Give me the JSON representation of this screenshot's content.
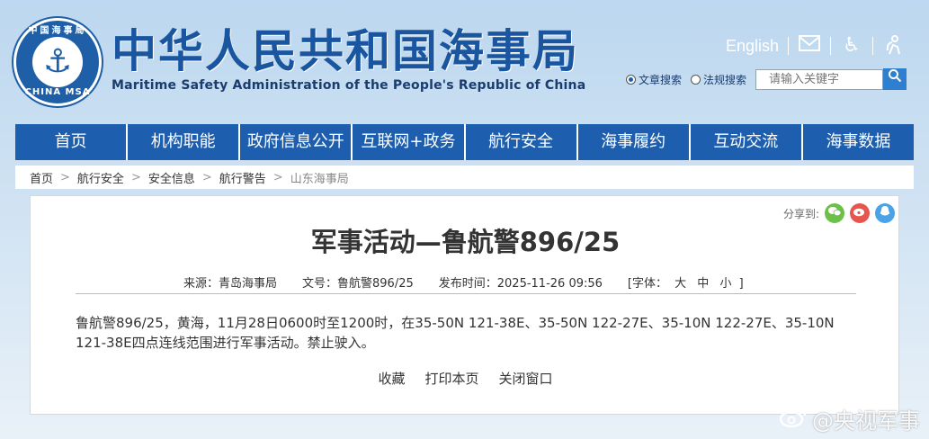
{
  "header": {
    "emblem_ring_top": "中国海事局",
    "emblem_ring_bottom": "CHINA MSA",
    "title": "中华人民共和国海事局",
    "subtitle": "Maritime Safety Administration of the People's Republic of China",
    "english_link": "English",
    "icons": [
      "mail-icon",
      "accessibility-icon",
      "elderly-icon"
    ],
    "search": {
      "option_article": "文章搜索",
      "option_regulation": "法规搜索",
      "selected": "文章搜索",
      "placeholder": "请输入关键字"
    }
  },
  "nav": {
    "items": [
      "首页",
      "机构职能",
      "政府信息公开",
      "互联网+政务",
      "航行安全",
      "海事履约",
      "互动交流",
      "海事数据"
    ]
  },
  "breadcrumb": [
    "首页",
    "航行安全",
    "安全信息",
    "航行警告",
    "山东海事局"
  ],
  "article": {
    "share_label": "分享到:",
    "share_icons": [
      "wechat-icon",
      "weibo-icon",
      "qq-icon"
    ],
    "title": "军事活动—鲁航警896/25",
    "meta": {
      "source": "来源：青岛海事局",
      "doc_no": "文号：鲁航警896/25",
      "publish_time": "发布时间：2025-11-26 09:56",
      "font_label": "[字体：",
      "font_large": "大",
      "font_medium": "中",
      "font_small": "小",
      "font_close": "]"
    },
    "body": "鲁航警896/25，黄海，11月28日0600时至1200时，在35-50N 121-38E、35-50N 122-27E、35-10N 122-27E、35-10N 121-38E四点连线范围进行军事活动。禁止驶入。",
    "actions": [
      "收藏",
      "打印本页",
      "关闭窗口"
    ]
  },
  "watermark": "@央视军事",
  "colors": {
    "nav_blue": "#1d5fae",
    "title_blue": "#1a56a0",
    "wechat_green": "#6cc04a",
    "weibo_red": "#e6564f",
    "qq_blue": "#4aa3e6"
  }
}
